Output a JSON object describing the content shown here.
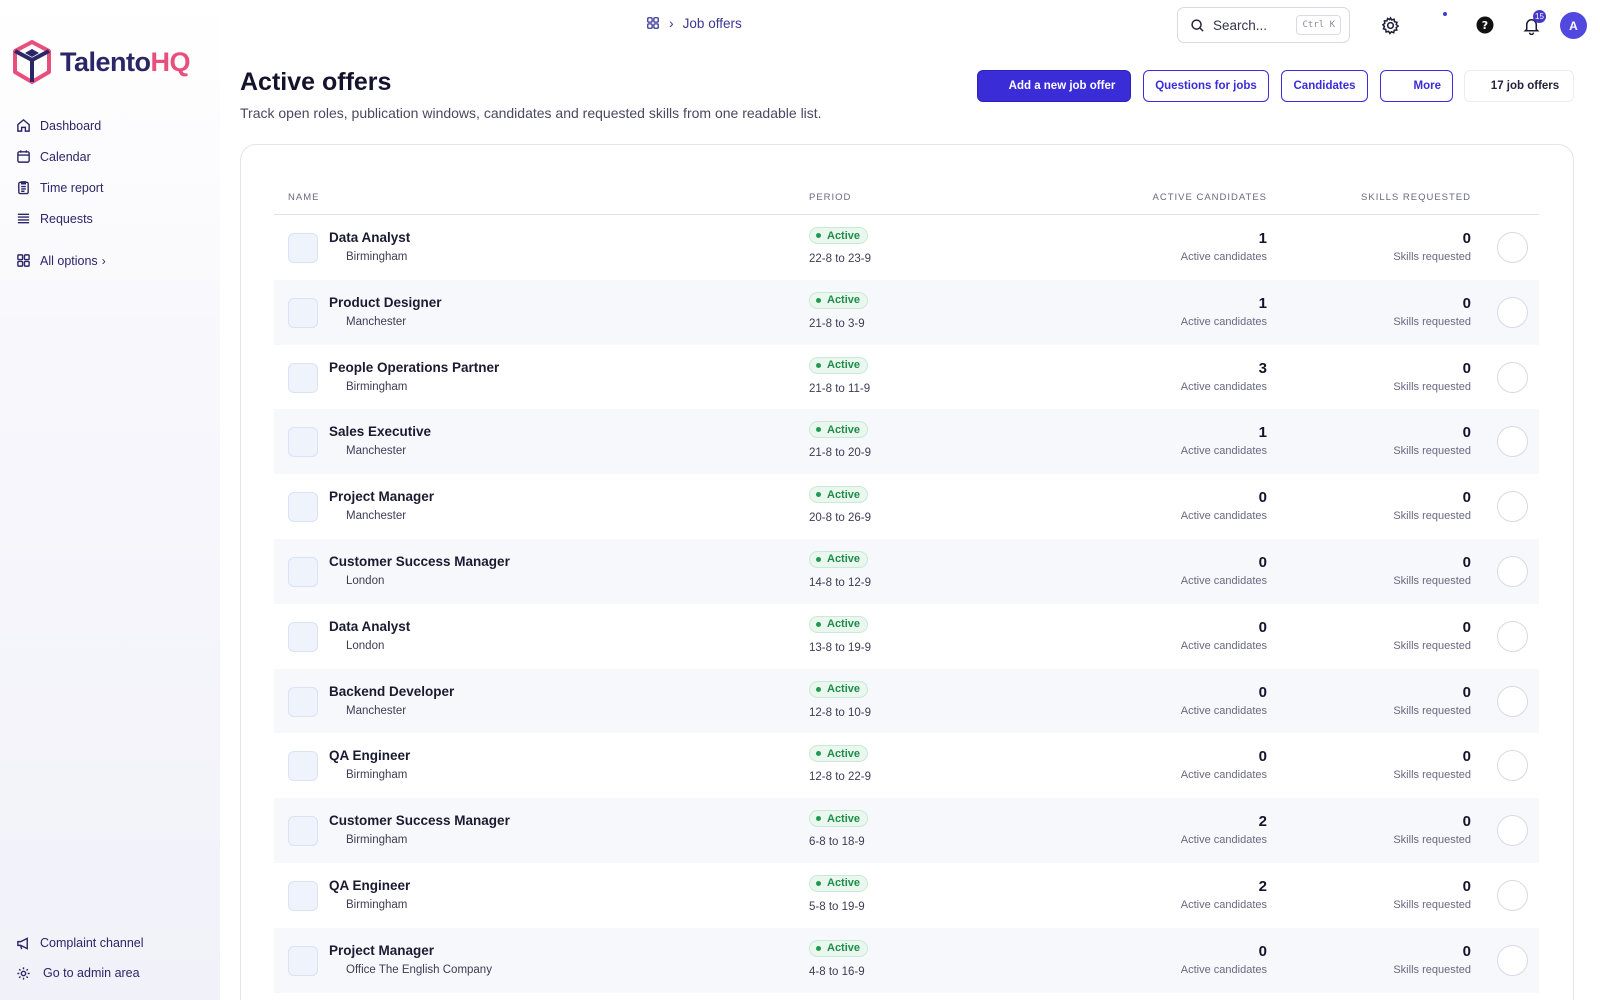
{
  "brand": {
    "name_part1": "Talento",
    "name_part2": "HQ"
  },
  "breadcrumb": {
    "current": "Job offers"
  },
  "search": {
    "placeholder": "Search...",
    "shortcut": "Ctrl K"
  },
  "notifications": {
    "count": "15"
  },
  "user": {
    "initial": "A"
  },
  "sidebar": {
    "items": [
      {
        "label": "Dashboard",
        "icon": "home-icon"
      },
      {
        "label": "Calendar",
        "icon": "calendar-icon"
      },
      {
        "label": "Time report",
        "icon": "clipboard-icon"
      },
      {
        "label": "Requests",
        "icon": "list-icon"
      }
    ],
    "all_options": "All options",
    "bottom": [
      {
        "label": "Complaint channel",
        "icon": "megaphone-icon"
      },
      {
        "label": "Go to admin area",
        "icon": "gear-icon"
      }
    ]
  },
  "header": {
    "title": "Active offers",
    "subtitle": "Track open roles, publication windows, candidates and requested skills from one readable list.",
    "add_button": "Add a new job offer",
    "questions_button": "Questions for jobs",
    "candidates_button": "Candidates",
    "more_button": "More",
    "count": "17 job offers"
  },
  "table": {
    "columns": {
      "name": "NAME",
      "period": "PERIOD",
      "candidates": "ACTIVE CANDIDATES",
      "skills": "SKILLS REQUESTED"
    },
    "rows": [
      {
        "name": "Data Analyst",
        "location": "Birmingham",
        "status": "Active",
        "period": "22-8 to 23-9",
        "candidates": "1",
        "candidates_label": "Active candidates",
        "skills": "0",
        "skills_label": "Skills requested"
      },
      {
        "name": "Product Designer",
        "location": "Manchester",
        "status": "Active",
        "period": "21-8 to 3-9",
        "candidates": "1",
        "candidates_label": "Active candidates",
        "skills": "0",
        "skills_label": "Skills requested"
      },
      {
        "name": "People Operations Partner",
        "location": "Birmingham",
        "status": "Active",
        "period": "21-8 to 11-9",
        "candidates": "3",
        "candidates_label": "Active candidates",
        "skills": "0",
        "skills_label": "Skills requested"
      },
      {
        "name": "Sales Executive",
        "location": "Manchester",
        "status": "Active",
        "period": "21-8 to 20-9",
        "candidates": "1",
        "candidates_label": "Active candidates",
        "skills": "0",
        "skills_label": "Skills requested"
      },
      {
        "name": "Project Manager",
        "location": "Manchester",
        "status": "Active",
        "period": "20-8 to 26-9",
        "candidates": "0",
        "candidates_label": "Active candidates",
        "skills": "0",
        "skills_label": "Skills requested"
      },
      {
        "name": "Customer Success Manager",
        "location": "London",
        "status": "Active",
        "period": "14-8 to 12-9",
        "candidates": "0",
        "candidates_label": "Active candidates",
        "skills": "0",
        "skills_label": "Skills requested"
      },
      {
        "name": "Data Analyst",
        "location": "London",
        "status": "Active",
        "period": "13-8 to 19-9",
        "candidates": "0",
        "candidates_label": "Active candidates",
        "skills": "0",
        "skills_label": "Skills requested"
      },
      {
        "name": "Backend Developer",
        "location": "Manchester",
        "status": "Active",
        "period": "12-8 to 10-9",
        "candidates": "0",
        "candidates_label": "Active candidates",
        "skills": "0",
        "skills_label": "Skills requested"
      },
      {
        "name": "QA Engineer",
        "location": "Birmingham",
        "status": "Active",
        "period": "12-8 to 22-9",
        "candidates": "0",
        "candidates_label": "Active candidates",
        "skills": "0",
        "skills_label": "Skills requested"
      },
      {
        "name": "Customer Success Manager",
        "location": "Birmingham",
        "status": "Active",
        "period": "6-8 to 18-9",
        "candidates": "2",
        "candidates_label": "Active candidates",
        "skills": "0",
        "skills_label": "Skills requested"
      },
      {
        "name": "QA Engineer",
        "location": "Birmingham",
        "status": "Active",
        "period": "5-8 to 19-9",
        "candidates": "2",
        "candidates_label": "Active candidates",
        "skills": "0",
        "skills_label": "Skills requested"
      },
      {
        "name": "Project Manager",
        "location": "Office The English Company",
        "status": "Active",
        "period": "4-8 to 16-9",
        "candidates": "0",
        "candidates_label": "Active candidates",
        "skills": "0",
        "skills_label": "Skills requested"
      }
    ]
  },
  "colors": {
    "accent": "#3a2dd8",
    "brand_dark": "#2b2668",
    "brand_pink": "#e84f7d",
    "status_active": "#1f8c4a"
  }
}
